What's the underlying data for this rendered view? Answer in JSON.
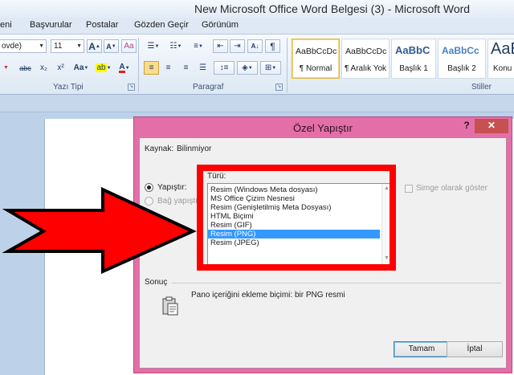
{
  "window": {
    "title": "New Microsoft Office Word Belgesi (3) - Microsoft Word"
  },
  "ribbon_tabs": [
    "eni",
    "Başvurular",
    "Postalar",
    "Gözden Geçir",
    "Görünüm"
  ],
  "font_group": {
    "font_name": "ovde)",
    "font_size": "11",
    "grow_label": "A",
    "shrink_label": "A",
    "clear_label": "Aa",
    "strike_label": "abc",
    "subscript_label": "x₂",
    "superscript_label": "x²",
    "case_label": "Aa",
    "highlight_label": "ab",
    "fontcolor_label": "A",
    "label": "Yazı Tipi"
  },
  "paragraph_group": {
    "sort_label": "A↓",
    "marks_label": "¶",
    "label": "Paragraf"
  },
  "styles_group": {
    "items": [
      {
        "sample": "AaBbCcDc",
        "name": "¶ Normal"
      },
      {
        "sample": "AaBbCcDc",
        "name": "¶ Aralık Yok"
      },
      {
        "sample": "AaBbC",
        "name": "Başlık 1"
      },
      {
        "sample": "AaBbCc",
        "name": "Başlık 2"
      },
      {
        "sample": "AaB",
        "name": "Konu"
      }
    ],
    "label": "Stiller"
  },
  "dialog": {
    "title": "Özel Yapıştır",
    "help": "?",
    "close": "✕",
    "source_label": "Kaynak:",
    "source_value": "Bilinmiyor",
    "type_label": "Türü:",
    "paste_label": "Yapıştır:",
    "paste_link_label": "Bağ yapıştır:",
    "display_as_icon_label": "Simge olarak göster",
    "types": [
      "Resim (Windows Meta dosyası)",
      "MS Office Çizim Nesnesi",
      "Resim (Genişletilmiş Meta Dosyası)",
      "HTML Biçimi",
      "Resim (GIF)",
      "Resim (PNG)",
      "Resim (JPEG)"
    ],
    "selected_type": "Resim (PNG)",
    "result_label": "Sonuç",
    "result_text": "Pano içeriğini ekleme biçimi: bir PNG resmi",
    "ok_label": "Tamam",
    "cancel_label": "İptal"
  },
  "colors": {
    "dialog_frame": "#e46fa8",
    "highlight_box": "#ff0000",
    "arrow_fill": "#ff0000",
    "list_selection": "#3399ff",
    "close_button": "#c75050"
  }
}
